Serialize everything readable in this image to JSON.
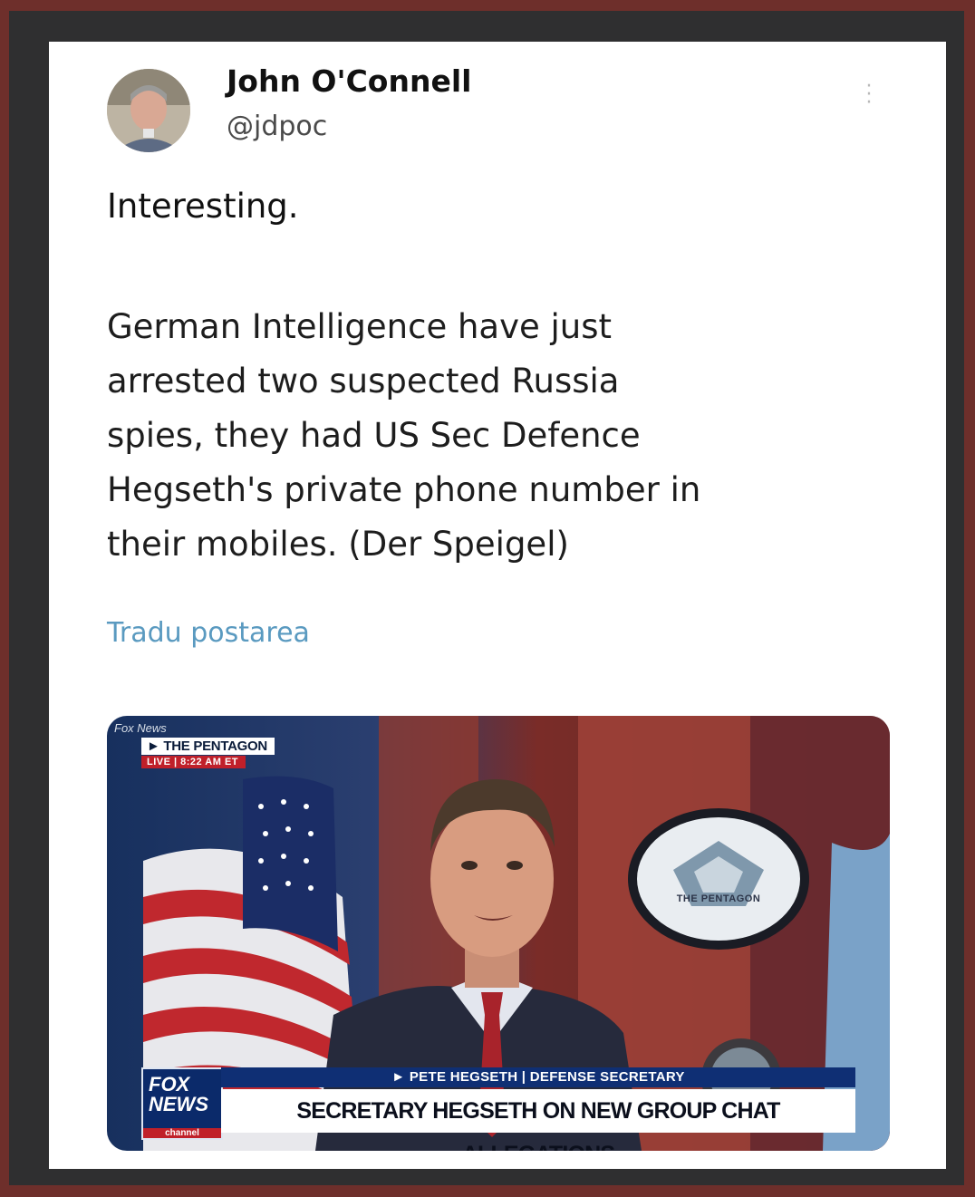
{
  "author": {
    "name": "John O'Connell",
    "handle": "@jdpoc",
    "avatar_icon": "avatar-photo"
  },
  "more_icon": "more-icon",
  "tweet": {
    "intro": "Interesting.",
    "body": "German Intelligence have just\narrested two suspected Russia\nspies, they had US Sec Defence\nHegseth's private phone number in\ntheir mobiles. (Der Speigel)",
    "translate_label": "Tradu postarea"
  },
  "media": {
    "watermark": "Fox News",
    "location": "► THE PENTAGON",
    "live_label": "LIVE  |  8:22 AM ET",
    "network_logo": "FOX NEWS",
    "network_sub": "channel",
    "lower_third_name": "► PETE HEGSETH | DEFENSE SECRETARY",
    "headline": "SECRETARY HEGSETH ON NEW GROUP CHAT ALLEGATIONS",
    "backdrop_seal": "THE PENTAGON"
  },
  "colors": {
    "outer_border": "#6e2f2b",
    "inner_frame": "#2f2f30",
    "link": "#5a9ac0",
    "fox_navy": "#0b2a6a",
    "fox_red": "#c0202a"
  }
}
